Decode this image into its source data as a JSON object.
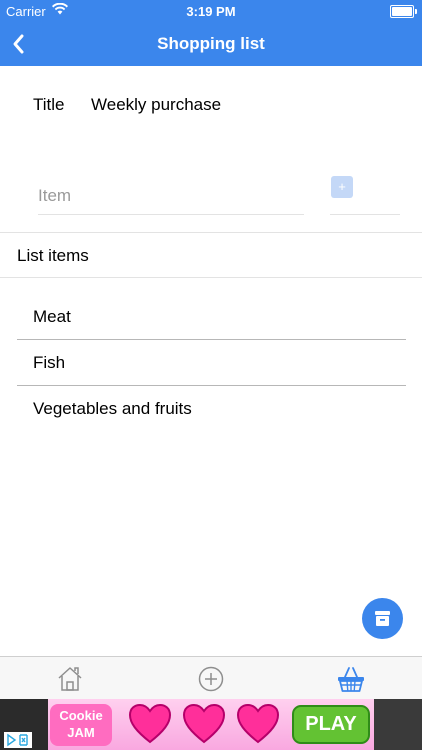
{
  "status_bar": {
    "carrier": "Carrier",
    "time": "3:19 PM"
  },
  "nav": {
    "title": "Shopping list"
  },
  "form": {
    "title_label": "Title",
    "title_value": "Weekly purchase",
    "item_placeholder": "Item",
    "add_label": "+"
  },
  "list": {
    "header": "List items",
    "items": [
      "Meat",
      "Fish",
      "Vegetables and fruits"
    ]
  },
  "tabs": [
    {
      "icon": "home-icon"
    },
    {
      "icon": "add-circle-icon"
    },
    {
      "icon": "basket-icon",
      "active": true
    }
  ],
  "ad": {
    "brand": "Cookie JAM",
    "cta": "PLAY"
  },
  "colors": {
    "accent": "#3b86ec",
    "add_button": "#c4d8f7",
    "ad_play": "#63c233"
  }
}
